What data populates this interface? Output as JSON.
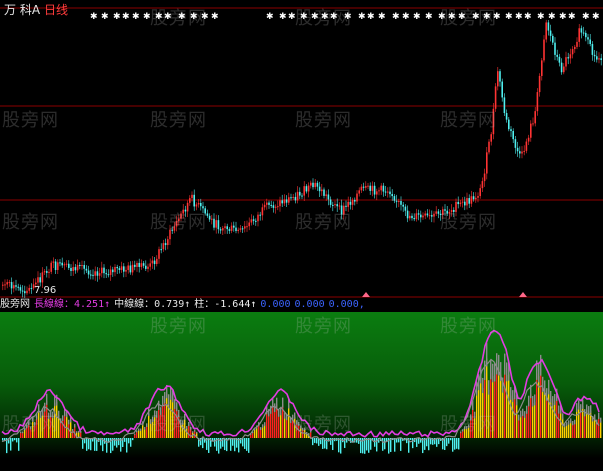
{
  "header": {
    "stock_name": "万 科A",
    "period": "日线"
  },
  "price_panel": {
    "low_label": "7.96"
  },
  "legend": {
    "brand": "股旁网",
    "long_line": "長線線：4.251↑",
    "mid_line": "中線線：0.739↑",
    "bar": "柱：-1.644↑",
    "v1": "0.000",
    "v2": "0.000",
    "v3": "0.000,"
  },
  "watermark": "股旁网",
  "colors": {
    "up": "#ff3333",
    "down": "#4ff0f0",
    "magenta": "#e23ce2",
    "grid": "#8b0000",
    "gray": "#8c8c8c"
  }
}
